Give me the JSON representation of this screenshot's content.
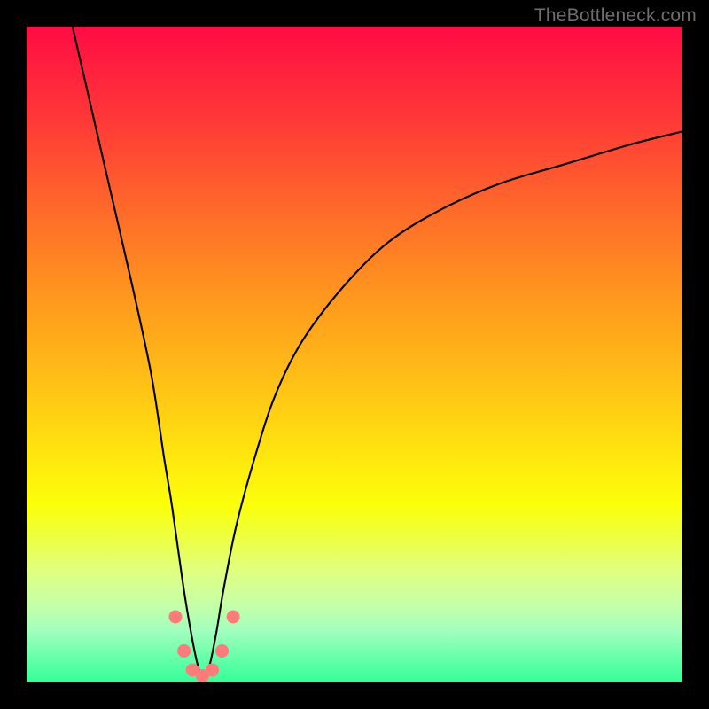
{
  "watermark": "TheBottleneck.com",
  "colors": {
    "frame_background": "#000000",
    "curve_stroke": "#000000",
    "marker_fill": "#ff7a7a",
    "marker_stroke": "#ff6b6b"
  },
  "chart_data": {
    "type": "line",
    "title": "",
    "xlabel": "",
    "ylabel": "",
    "xlim": [
      0,
      100
    ],
    "ylim": [
      0,
      100
    ],
    "grid": false,
    "curve_min_x": 27,
    "series": [
      {
        "name": "bottleneck_curve",
        "x": [
          7,
          10,
          13,
          16,
          19,
          21,
          22,
          23,
          24,
          25,
          26,
          27,
          28,
          29,
          30,
          32,
          35,
          38,
          42,
          48,
          55,
          63,
          72,
          82,
          92,
          100
        ],
        "y": [
          100,
          87,
          74,
          61,
          47,
          34,
          28,
          21,
          14,
          8,
          3,
          0,
          3,
          8,
          14,
          24,
          35,
          44,
          52,
          60,
          67,
          72,
          76,
          79,
          82,
          84
        ]
      }
    ],
    "markers": [
      {
        "x": 22.7,
        "y": 10.0
      },
      {
        "x": 24.0,
        "y": 4.8
      },
      {
        "x": 25.3,
        "y": 1.9
      },
      {
        "x": 26.8,
        "y": 1.0
      },
      {
        "x": 28.3,
        "y": 1.9
      },
      {
        "x": 29.8,
        "y": 4.8
      },
      {
        "x": 31.5,
        "y": 10.0
      }
    ]
  }
}
